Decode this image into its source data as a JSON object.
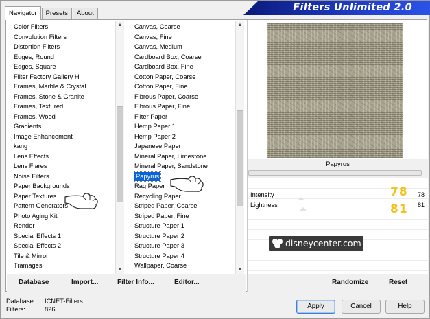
{
  "banner_title": "Filters Unlimited 2.0",
  "tabs": [
    {
      "label": "Navigator",
      "active": true
    },
    {
      "label": "Presets",
      "active": false
    },
    {
      "label": "About",
      "active": false
    }
  ],
  "categories": [
    "Color Filters",
    "Convolution Filters",
    "Distortion Filters",
    "Edges, Round",
    "Edges, Square",
    "Filter Factory Gallery H",
    "Frames, Marble & Crystal",
    "Frames, Stone & Granite",
    "Frames, Textured",
    "Frames, Wood",
    "Gradients",
    "Image Enhancement",
    "kang",
    "Lens Effects",
    "Lens Flares",
    "Noise Filters",
    "Paper Backgrounds",
    "Paper Textures",
    "Pattern Generators",
    "Photo Aging Kit",
    "Render",
    "Special Effects 1",
    "Special Effects 2",
    "Tile & Mirror",
    "Tramages"
  ],
  "selected_category": "Paper Textures",
  "filters": [
    "Canvas, Coarse",
    "Canvas, Fine",
    "Canvas, Medium",
    "Cardboard Box, Coarse",
    "Cardboard Box, Fine",
    "Cotton Paper, Coarse",
    "Cotton Paper, Fine",
    "Fibrous Paper, Coarse",
    "Fibrous Paper, Fine",
    "Filter Paper",
    "Hemp Paper 1",
    "Hemp Paper 2",
    "Japanese Paper",
    "Mineral Paper, Limestone",
    "Mineral Paper, Sandstone",
    "Papyrus",
    "Rag Paper",
    "Recycling Paper",
    "Striped Paper, Coarse",
    "Striped Paper, Fine",
    "Structure Paper 1",
    "Structure Paper 2",
    "Structure Paper 3",
    "Structure Paper 4",
    "Wallpaper, Coarse"
  ],
  "selected_filter": "Papyrus",
  "left_buttons": {
    "database": "Database",
    "import": "Import...",
    "filter_info": "Filter Info...",
    "editor": "Editor..."
  },
  "preview": {
    "filter_name": "Papyrus",
    "colors": {
      "base": "#a8a38e",
      "dark": "#3c3a2d",
      "light": "#e6e2cd"
    }
  },
  "controls": [
    {
      "label": "Intensity",
      "value": 78,
      "level": 0.31
    },
    {
      "label": "Lightness",
      "value": 81,
      "level": 0.32
    }
  ],
  "overlay_values": {
    "intensity": "78",
    "lightness": "81"
  },
  "watermark": "disneycenter.com",
  "right_buttons": {
    "randomize": "Randomize",
    "reset": "Reset"
  },
  "status": {
    "database_label": "Database:",
    "database_value": "ICNET-Filters",
    "filters_label": "Filters:",
    "filters_value": "826"
  },
  "footer_buttons": {
    "apply": "Apply",
    "cancel": "Cancel",
    "help": "Help"
  },
  "scrollbars": {
    "categories_position": 0.55,
    "filters_position": 0.58
  }
}
